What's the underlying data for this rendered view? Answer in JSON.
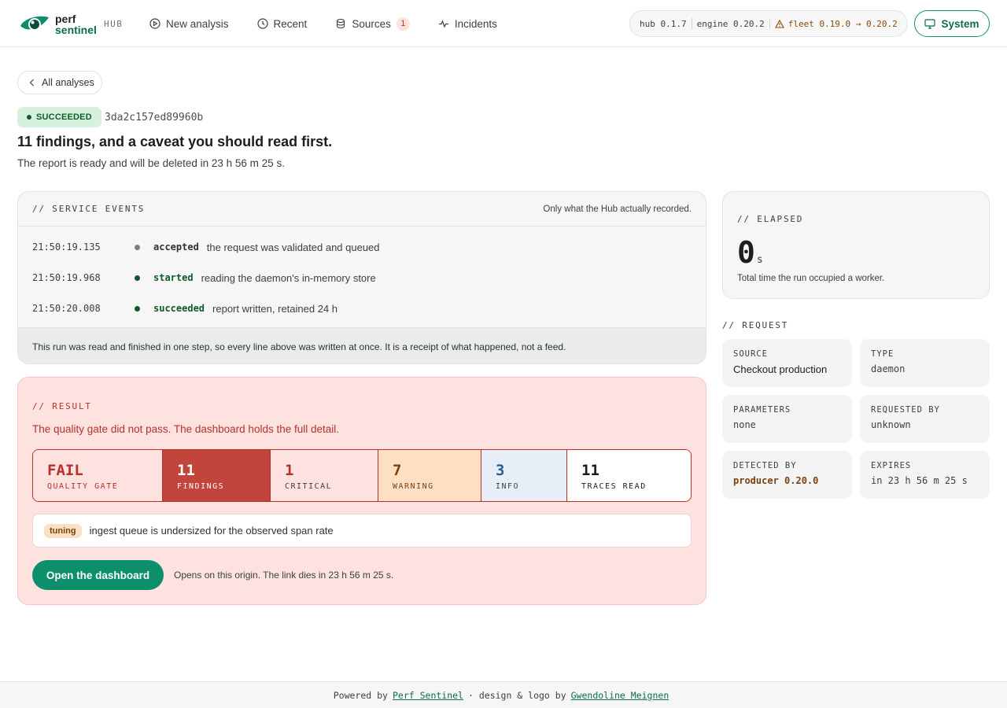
{
  "header": {
    "logo_line1": "perf",
    "logo_line2": "sentinel",
    "hub": "HUB",
    "nav": [
      {
        "label": "New analysis",
        "icon": "play-circle-icon"
      },
      {
        "label": "Recent",
        "icon": "clock-icon"
      },
      {
        "label": "Sources",
        "icon": "database-icon",
        "badge": "1"
      },
      {
        "label": "Incidents",
        "icon": "activity-icon"
      }
    ],
    "versions": {
      "hub": "hub 0.1.7",
      "engine": "engine 0.20.2",
      "fleet": "fleet 0.19.0 → 0.20.2"
    },
    "system_label": "System"
  },
  "back_label": "All analyses",
  "run": {
    "status": "SUCCEEDED",
    "id": "3da2c157ed89960b",
    "title": "11 findings, and a caveat you should read first.",
    "subtitle": "The report is ready and will be deleted in 23 h 56 m 25 s."
  },
  "events": {
    "label": "// SERVICE EVENTS",
    "note": "Only what the Hub actually recorded.",
    "rows": [
      {
        "time": "21:50:19.135",
        "kind": "accepted",
        "desc": "the request was validated and queued"
      },
      {
        "time": "21:50:19.968",
        "kind": "started",
        "desc": "reading the daemon's in-memory store"
      },
      {
        "time": "21:50:20.008",
        "kind": "succeeded",
        "desc": "report written, retained 24 h"
      }
    ],
    "footer": "This run was read and finished in one step, so every line above was written at once. It is a receipt of what happened, not a feed."
  },
  "result": {
    "label": "// RESULT",
    "message": "The quality gate did not pass. The dashboard holds the full detail.",
    "stats": [
      {
        "value": "FAIL",
        "label": "QUALITY GATE"
      },
      {
        "value": "11",
        "label": "FINDINGS"
      },
      {
        "value": "1",
        "label": "CRITICAL"
      },
      {
        "value": "7",
        "label": "WARNING"
      },
      {
        "value": "3",
        "label": "INFO"
      },
      {
        "value": "11",
        "label": "TRACES READ"
      }
    ],
    "finding_tag": "tuning",
    "finding_text": "ingest queue is undersized for the observed span rate",
    "button": "Open the dashboard",
    "button_note": "Opens on this origin. The link dies in 23 h 56 m 25 s."
  },
  "elapsed": {
    "label": "// ELAPSED",
    "value": "0",
    "unit": "s",
    "sub": "Total time the run occupied a worker."
  },
  "request": {
    "label": "// REQUEST",
    "tiles": [
      {
        "key": "SOURCE",
        "value": "Checkout production"
      },
      {
        "key": "TYPE",
        "value": "daemon"
      },
      {
        "key": "PARAMETERS",
        "value": "none"
      },
      {
        "key": "REQUESTED BY",
        "value": "unknown"
      },
      {
        "key": "DETECTED BY",
        "value": "producer 0.20.0"
      },
      {
        "key": "EXPIRES",
        "value": "in 23 h 56 m 25 s"
      }
    ]
  },
  "footer": {
    "prefix": "Powered by",
    "link1": "Perf Sentinel",
    "middle": "· design & logo by",
    "link2": "Gwendoline Meignen"
  },
  "colors": {
    "brand": "#0e8f6b",
    "danger": "#b5322a",
    "success_bg": "#d6f1dd"
  }
}
